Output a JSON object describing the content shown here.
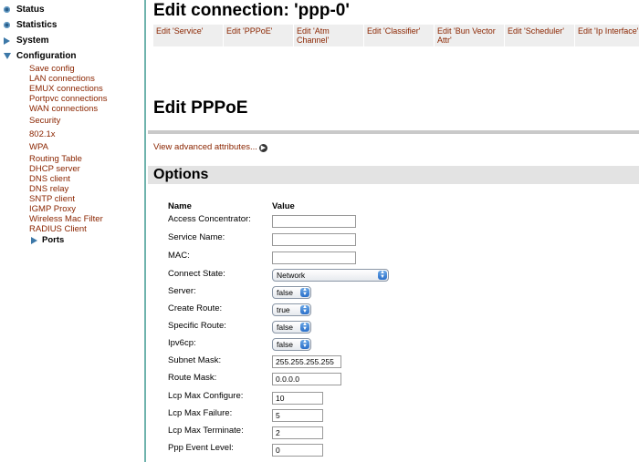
{
  "sidebar": {
    "status": "Status",
    "statistics": "Statistics",
    "system": "System",
    "configuration": "Configuration",
    "items": [
      "Save config",
      "LAN connections",
      "EMUX connections",
      "Portpvc connections",
      "WAN connections",
      "Security",
      "802.1x",
      "WPA",
      "Routing Table",
      "DHCP server",
      "DNS client",
      "DNS relay",
      "SNTP client",
      "IGMP Proxy",
      "Wireless Mac Filter",
      "RADIUS Client"
    ],
    "ports": "Ports"
  },
  "header": {
    "title": "Edit connection: 'ppp-0'",
    "tabs": [
      "Edit 'Service'",
      "Edit 'PPPoE'",
      "Edit 'Atm Channel'",
      "Edit 'Classifier'",
      "Edit 'Bun Vector Attr'",
      "Edit 'Scheduler'",
      "Edit 'Ip Interface'"
    ]
  },
  "section": {
    "title": "Edit PPPoE",
    "advanced_link": "View advanced attributes...",
    "options_title": "Options"
  },
  "options": {
    "col_name": "Name",
    "col_value": "Value",
    "fields": [
      {
        "label": "Access Concentrator:",
        "value": ""
      },
      {
        "label": "Service Name:",
        "value": ""
      },
      {
        "label": "MAC:",
        "value": ""
      },
      {
        "label": "Connect State:",
        "value": "Network"
      },
      {
        "label": "Server:",
        "value": "false"
      },
      {
        "label": "Create Route:",
        "value": "true"
      },
      {
        "label": "Specific Route:",
        "value": "false"
      },
      {
        "label": "Ipv6cp:",
        "value": "false"
      },
      {
        "label": "Subnet Mask:",
        "value": "255.255.255.255"
      },
      {
        "label": "Route Mask:",
        "value": "0.0.0.0"
      },
      {
        "label": "Lcp Max Configure:",
        "value": "10"
      },
      {
        "label": "Lcp Max Failure:",
        "value": "5"
      },
      {
        "label": "Lcp Max Terminate:",
        "value": "2"
      },
      {
        "label": "Ppp Event Level:",
        "value": "0"
      }
    ]
  }
}
